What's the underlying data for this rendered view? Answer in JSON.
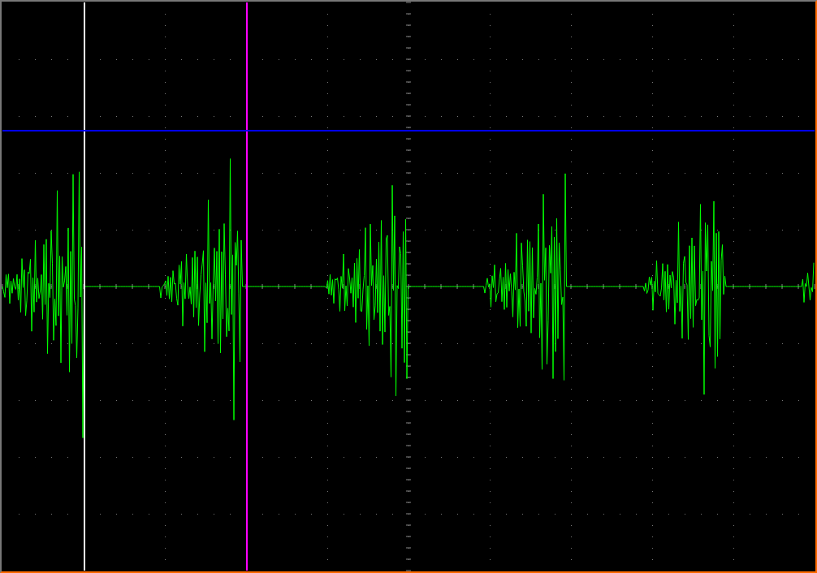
{
  "cursors": [
    {
      "kind": "vertical",
      "color": "#ffffff"
    },
    {
      "kind": "vertical",
      "color": "#ff00ff"
    },
    {
      "kind": "horizontal",
      "color": "#0000ff"
    }
  ]
}
